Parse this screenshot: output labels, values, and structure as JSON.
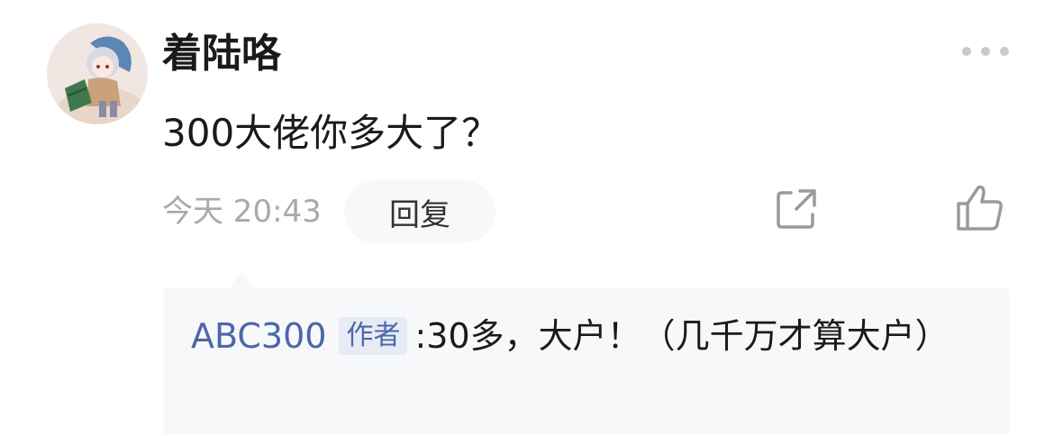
{
  "comment": {
    "username": "着陆咯",
    "text": "300大佬你多大了？",
    "time": "今天 20:43",
    "reply_label": "回复",
    "icons": {
      "more": "more-dots-icon",
      "share": "share-icon",
      "like": "thumbs-up-icon"
    }
  },
  "reply": {
    "author": "ABC300",
    "badge": "作者",
    "text": ":30多，大户！（几千万才算大户）"
  },
  "colors": {
    "author_link": "#4b67a8",
    "badge_bg": "#e7ebf5",
    "muted_text": "#a9a9a9",
    "reply_bg": "#f7f8fa"
  }
}
